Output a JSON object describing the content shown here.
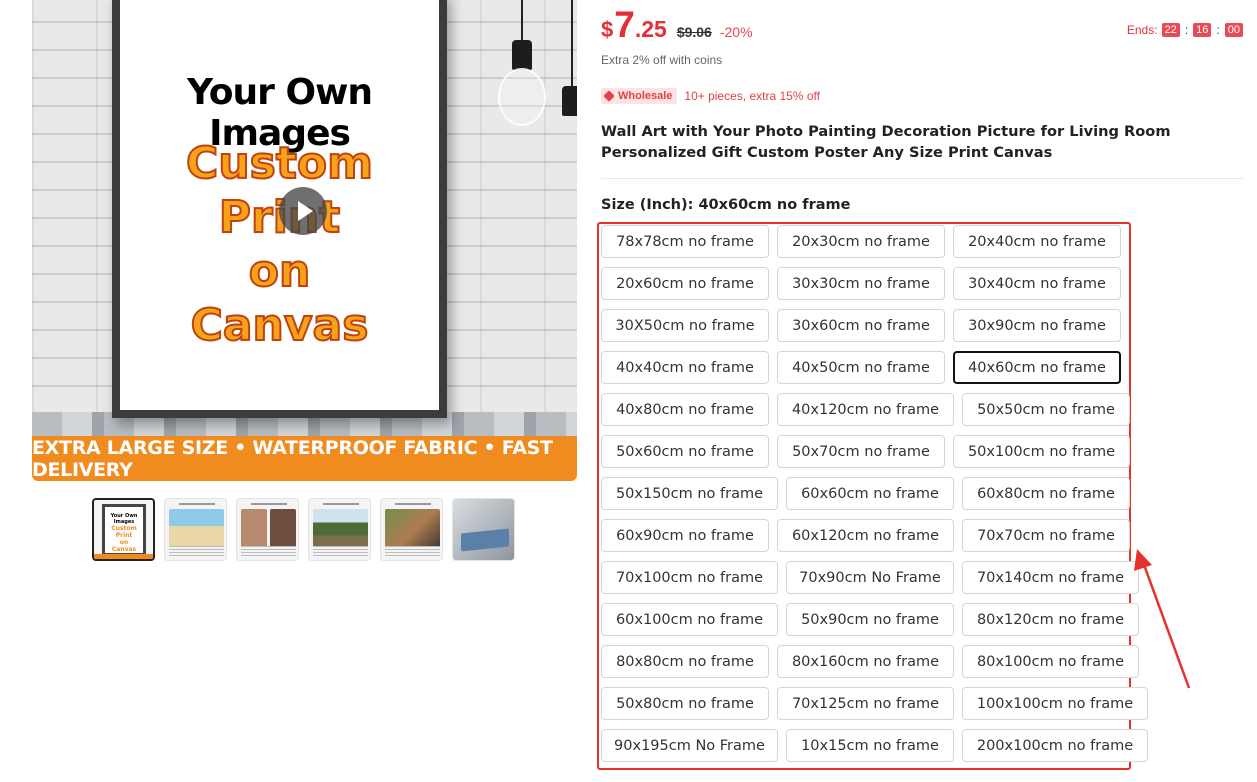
{
  "gallery": {
    "image_heading": "Your Own Images",
    "image_text_lines": [
      "Custom",
      "Print",
      "on",
      "Canvas"
    ],
    "banner": "EXTRA LARGE SIZE • WATERPROOF FABRIC • FAST DELIVERY",
    "thumbnail_count": 6,
    "active_thumbnail": 0
  },
  "price": {
    "currency": "$",
    "integer": "7",
    "decimal": ".25",
    "original": "$9.06",
    "discount": "-20%"
  },
  "countdown": {
    "label": "Ends:",
    "hours": "22",
    "minutes": "16",
    "seconds": "00",
    "separator": ":"
  },
  "coins_text": "Extra 2% off with coins",
  "wholesale": {
    "tag": "Wholesale",
    "text": "10+ pieces, extra 15% off"
  },
  "product_title": "Wall Art with Your Photo Painting Decoration Picture for Living Room Personalized Gift Custom Poster Any Size Print Canvas",
  "size_selector": {
    "label": "Size (Inch): 40x60cm no frame",
    "selected": "40x60cm no frame",
    "rows": [
      [
        "78x78cm no frame",
        "20x30cm no frame",
        "20x40cm no frame"
      ],
      [
        "20x60cm no frame",
        "30x30cm no frame",
        "30x40cm no frame"
      ],
      [
        "30X50cm no frame",
        "30x60cm no frame",
        "30x90cm no frame"
      ],
      [
        "40x40cm no frame",
        "40x50cm no frame",
        "40x60cm no frame"
      ],
      [
        "40x80cm no frame",
        "40x120cm no frame",
        "50x50cm no frame"
      ],
      [
        "50x60cm no frame",
        "50x70cm no frame",
        "50x100cm no frame"
      ],
      [
        "50x150cm no frame",
        "60x60cm no frame",
        "60x80cm no frame"
      ],
      [
        "60x90cm no frame",
        "60x120cm no frame",
        "70x70cm no frame"
      ],
      [
        "70x100cm no frame",
        "70x90cm No Frame",
        "70x140cm no frame"
      ],
      [
        "60x100cm no frame",
        "50x90cm no frame",
        "80x120cm no frame"
      ],
      [
        "80x80cm no frame",
        "80x160cm no frame",
        "80x100cm no frame"
      ],
      [
        "50x80cm no frame",
        "70x125cm no frame",
        "100x100cm no frame"
      ],
      [
        "90x195cm No Frame",
        "10x15cm no frame",
        "200x100cm no frame"
      ]
    ]
  },
  "colors": {
    "price_red": "#e62e3a",
    "highlight_red": "#e6322c",
    "banner_orange": "#ef8b1f"
  },
  "icons": {
    "play": "play-icon",
    "wholesale_tag": "tag-icon",
    "annotation": "red-arrow-icon"
  }
}
